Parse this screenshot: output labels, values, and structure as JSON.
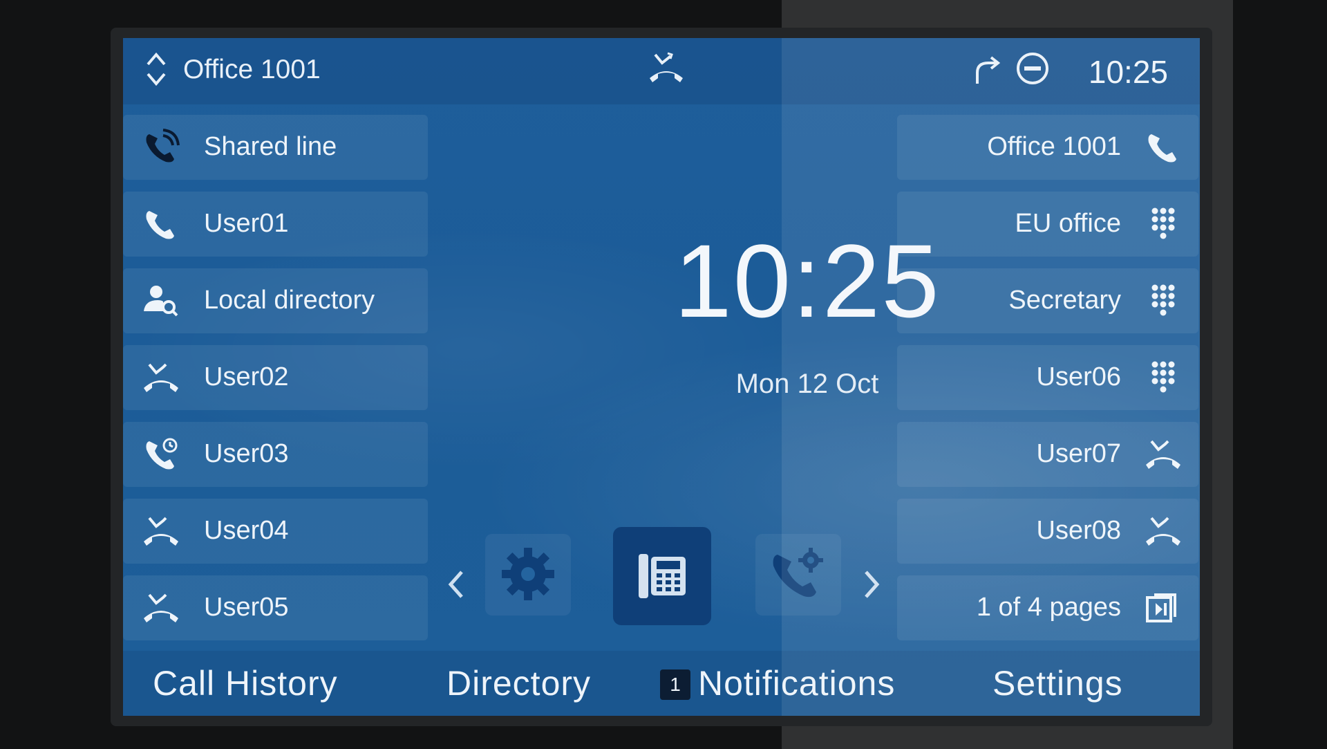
{
  "status_bar": {
    "line_selector_icon": "up-down-chevron",
    "title": "Office 1001",
    "center_icon": "missed-call",
    "icons": [
      "forward-arrow",
      "do-not-disturb"
    ],
    "time": "10:25"
  },
  "left_keys": [
    {
      "label": "Shared line",
      "icon": "phone-ringing"
    },
    {
      "label": "User01",
      "icon": "phone"
    },
    {
      "label": "Local directory",
      "icon": "person-search"
    },
    {
      "label": "User02",
      "icon": "missed-call"
    },
    {
      "label": "User03",
      "icon": "phone-timer"
    },
    {
      "label": "User04",
      "icon": "missed-call"
    },
    {
      "label": "User05",
      "icon": "missed-call"
    }
  ],
  "right_keys": [
    {
      "label": "Office 1001",
      "icon": "phone"
    },
    {
      "label": "EU office",
      "icon": "dialpad"
    },
    {
      "label": "Secretary",
      "icon": "dialpad"
    },
    {
      "label": "User06",
      "icon": "dialpad"
    },
    {
      "label": "User07",
      "icon": "missed-call"
    },
    {
      "label": "User08",
      "icon": "missed-call"
    },
    {
      "label": "1 of 4 pages",
      "icon": "next-page"
    }
  ],
  "clock": {
    "time": "10:25",
    "date": "Mon 12 Oct"
  },
  "dock": {
    "items": [
      "settings-gear",
      "desk-phone",
      "phone-settings"
    ],
    "active": "desk-phone"
  },
  "softkeys": {
    "call_history": "Call History",
    "directory": "Directory",
    "notifications": "Notifications",
    "notifications_count": "1",
    "settings": "Settings"
  },
  "colors": {
    "screen_bg": "#1d5e99",
    "active_dock": "#0f3f78",
    "text": "#eef4fa",
    "bezel": "#232527",
    "badge": "#0c1d33"
  }
}
